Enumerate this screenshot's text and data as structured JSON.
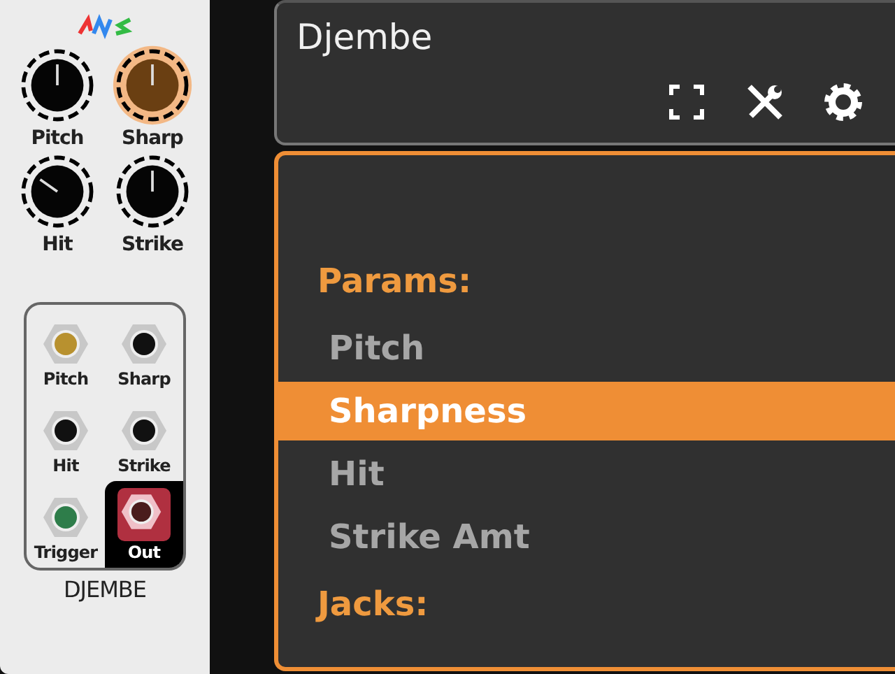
{
  "module": {
    "name": "DJEMBE",
    "knobs": [
      {
        "label": "Pitch",
        "selected": false
      },
      {
        "label": "Sharp",
        "selected": true
      },
      {
        "label": "Hit",
        "selected": false
      },
      {
        "label": "Strike",
        "selected": false
      }
    ],
    "jacks": [
      {
        "label": "Pitch",
        "kind": "input",
        "color": "#b8912f"
      },
      {
        "label": "Sharp",
        "kind": "input",
        "color": "#111111"
      },
      {
        "label": "Hit",
        "kind": "input",
        "color": "#111111"
      },
      {
        "label": "Strike",
        "kind": "input",
        "color": "#111111"
      },
      {
        "label": "Trigger",
        "kind": "input",
        "color": "#2e7d4a"
      },
      {
        "label": "Out",
        "kind": "output",
        "color": "#4a1c1c"
      }
    ]
  },
  "menu": {
    "title": "Djembe",
    "items": [
      {
        "kind": "header",
        "label": "Params:"
      },
      {
        "kind": "item",
        "label": "Pitch",
        "selected": false
      },
      {
        "kind": "item",
        "label": "Sharpness",
        "selected": true
      },
      {
        "kind": "item",
        "label": "Hit",
        "selected": false
      },
      {
        "kind": "item",
        "label": "Strike Amt",
        "selected": false
      },
      {
        "kind": "header",
        "label": "Jacks:"
      }
    ]
  }
}
